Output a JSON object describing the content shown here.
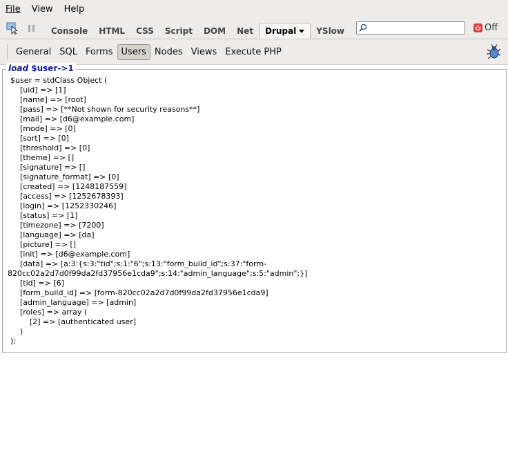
{
  "menu": {
    "file": "File",
    "view": "View",
    "help": "Help"
  },
  "firebug_tabs": [
    {
      "label": "Console",
      "active": false
    },
    {
      "label": "HTML",
      "active": false
    },
    {
      "label": "CSS",
      "active": false
    },
    {
      "label": "Script",
      "active": false
    },
    {
      "label": "DOM",
      "active": false
    },
    {
      "label": "Net",
      "active": false
    },
    {
      "label": "Drupal",
      "active": true
    },
    {
      "label": "YSlow",
      "active": false
    }
  ],
  "search": {
    "value": "",
    "placeholder": ""
  },
  "power": {
    "label": "Off"
  },
  "drupal_tabs": [
    {
      "label": "General",
      "active": false
    },
    {
      "label": "SQL",
      "active": false
    },
    {
      "label": "Forms",
      "active": false
    },
    {
      "label": "Users",
      "active": true
    },
    {
      "label": "Nodes",
      "active": false
    },
    {
      "label": "Views",
      "active": false
    },
    {
      "label": "Execute PHP",
      "active": false
    }
  ],
  "panel": {
    "legend_prefix": "load ",
    "legend_var": "$user->1",
    "dump_lines": [
      "$user = stdClass Object (",
      "    [uid] => [1]",
      "    [name] => [root]",
      "    [pass] => [**Not shown for security reasons**]",
      "    [mail] => [d6@example.com]",
      "    [mode] => [0]",
      "    [sort] => [0]",
      "    [threshold] => [0]",
      "    [theme] => []",
      "    [signature] => []",
      "    [signature_format] => [0]",
      "    [created] => [1248187559]",
      "    [access] => [1252678393]",
      "    [login] => [1252330246]",
      "    [status] => [1]",
      "    [timezone] => [7200]",
      "    [language] => [da]",
      "    [picture] => []",
      "    [init] => [d6@example.com]",
      "    [data] => [a:3:{s:3:\"tid\";s:1:\"6\";s:13:\"form_build_id\";s:37:\"form-",
      "820cc02a2d7d0f99da2fd37956e1cda9\";s:14:\"admin_language\";s:5:\"admin\";}]",
      "    [tid] => [6]",
      "    [form_build_id] => [form-820cc02a2d7d0f99da2fd37956e1cda9]",
      "    [admin_language] => [admin]",
      "    [roles] => array (",
      "        [2] => [authenticated user]",
      "    )",
      ");"
    ]
  }
}
